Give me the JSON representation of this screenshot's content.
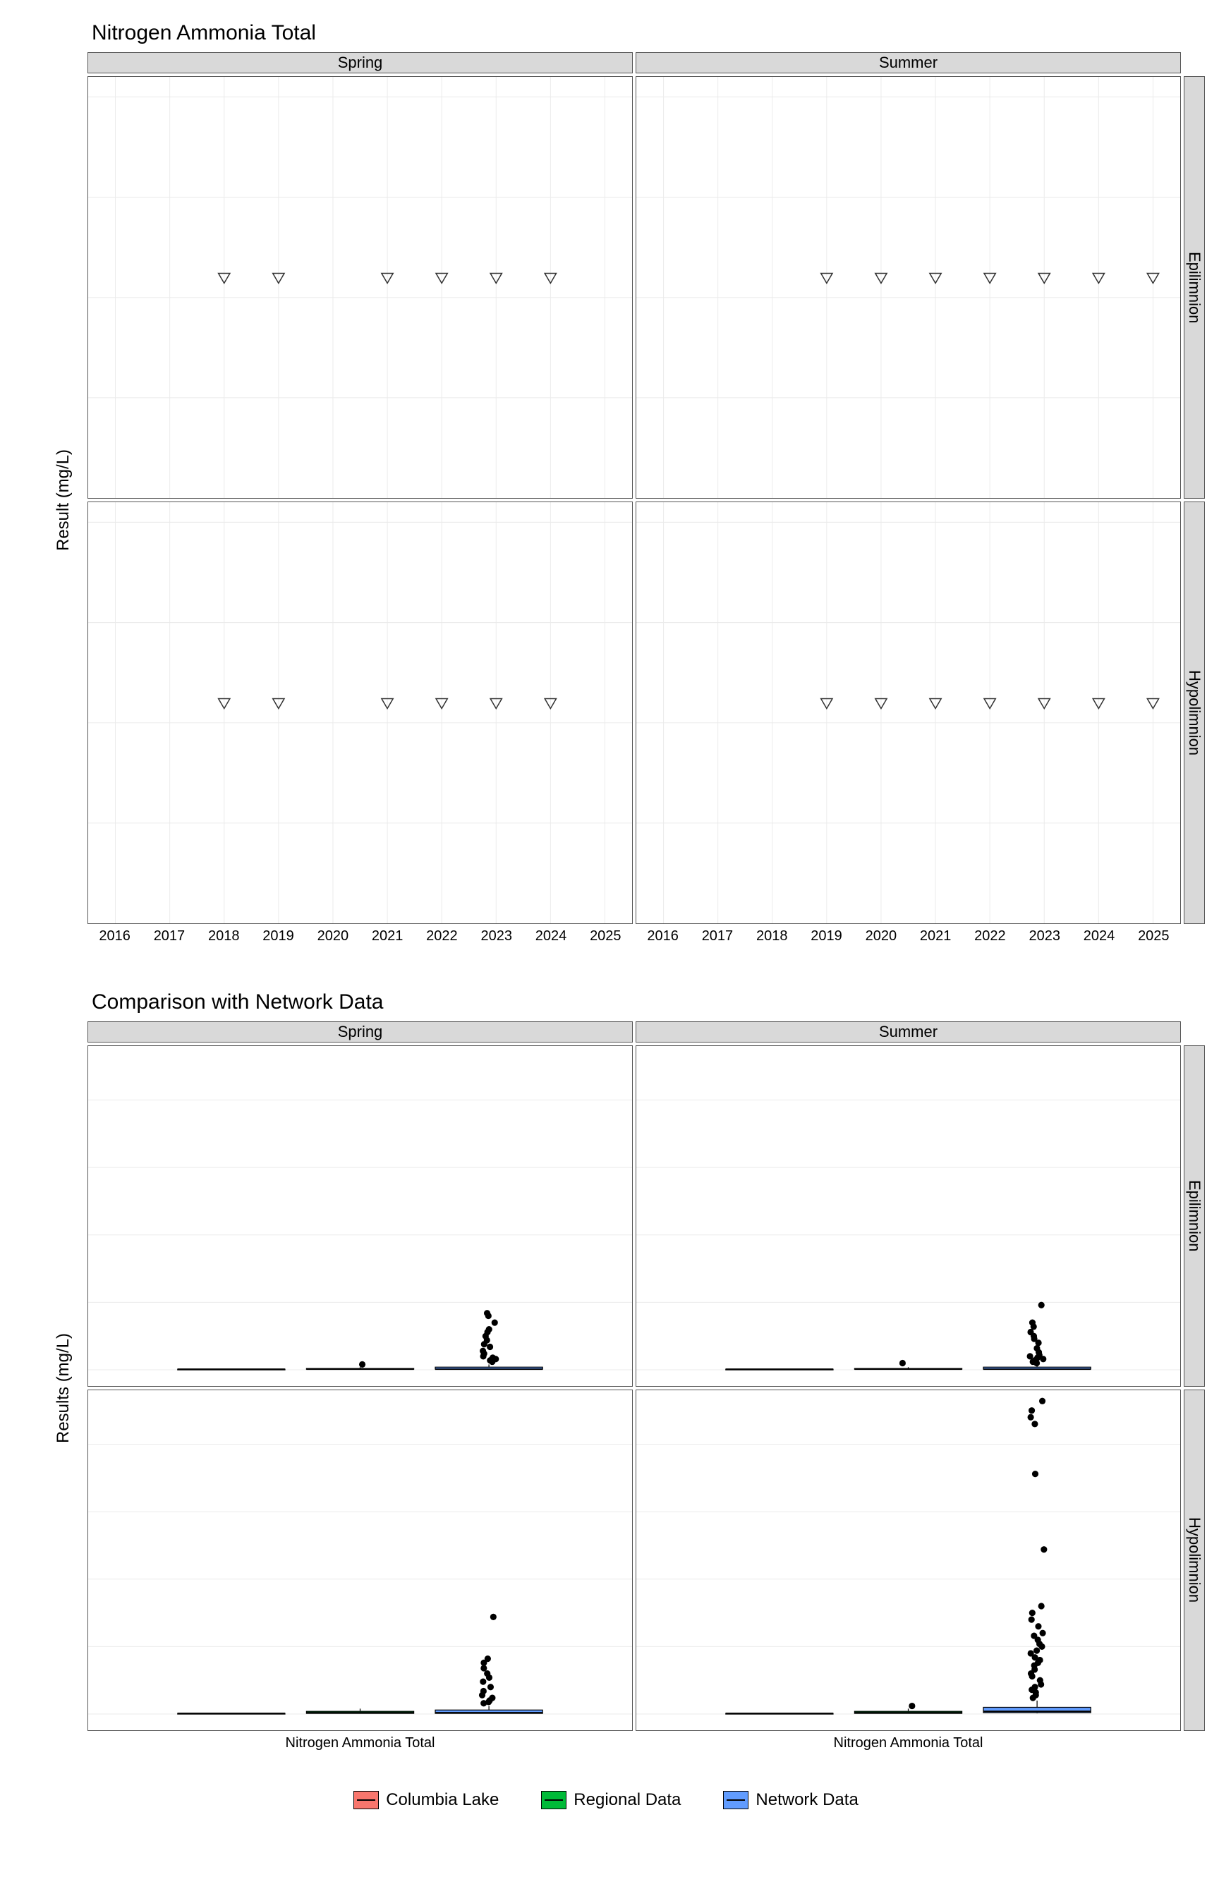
{
  "chart_data": [
    {
      "id": "top",
      "type": "scatter",
      "title": "Nitrogen Ammonia Total",
      "ylabel": "Result (mg/L)",
      "xlabel": "",
      "x_ticks": [
        "2016",
        "2017",
        "2018",
        "2019",
        "2020",
        "2021",
        "2022",
        "2023",
        "2024",
        "2025"
      ],
      "y_ticks": [
        -0.025,
        0.0,
        0.025,
        0.05
      ],
      "ylim": [
        -0.05,
        0.055
      ],
      "col_facets": [
        "Spring",
        "Summer"
      ],
      "row_facets": [
        "Epilimnion",
        "Hypolimnion"
      ],
      "marker": "open-triangle-down",
      "panels": {
        "Spring|Epilimnion": {
          "x": [
            2018,
            2019,
            2021,
            2022,
            2023,
            2024
          ],
          "y": [
            0.005,
            0.005,
            0.005,
            0.005,
            0.005,
            0.005
          ]
        },
        "Summer|Epilimnion": {
          "x": [
            2019,
            2020,
            2021,
            2022,
            2023,
            2024,
            2025
          ],
          "y": [
            0.005,
            0.005,
            0.005,
            0.005,
            0.005,
            0.005,
            0.005
          ]
        },
        "Spring|Hypolimnion": {
          "x": [
            2018,
            2019,
            2021,
            2022,
            2023,
            2024
          ],
          "y": [
            0.005,
            0.005,
            0.005,
            0.005,
            0.005,
            0.005
          ]
        },
        "Summer|Hypolimnion": {
          "x": [
            2019,
            2020,
            2021,
            2022,
            2023,
            2024,
            2025
          ],
          "y": [
            0.005,
            0.005,
            0.005,
            0.005,
            0.005,
            0.005,
            0.005
          ]
        }
      }
    },
    {
      "id": "bottom",
      "type": "boxplot",
      "title": "Comparison with Network Data",
      "ylabel": "Results (mg/L)",
      "xlabel": "",
      "x_category": "Nitrogen Ammonia Total",
      "y_ticks": [
        0.0,
        0.5,
        1.0,
        1.5,
        2.0
      ],
      "ylim": [
        -0.12,
        2.4
      ],
      "col_facets": [
        "Spring",
        "Summer"
      ],
      "row_facets": [
        "Epilimnion",
        "Hypolimnion"
      ],
      "groups": [
        "Columbia Lake",
        "Regional Data",
        "Network Data"
      ],
      "group_colors": {
        "Columbia Lake": "#F8766D",
        "Regional Data": "#00BA38",
        "Network Data": "#619CFF"
      },
      "panels": {
        "Spring|Epilimnion": {
          "box": [
            {
              "g": "Columbia Lake",
              "q1": 0.005,
              "med": 0.005,
              "q3": 0.005,
              "lo": 0.005,
              "hi": 0.005,
              "out": []
            },
            {
              "g": "Regional Data",
              "q1": 0.005,
              "med": 0.005,
              "q3": 0.01,
              "lo": 0.005,
              "hi": 0.02,
              "out": [
                0.04
              ]
            },
            {
              "g": "Network Data",
              "q1": 0.005,
              "med": 0.005,
              "q3": 0.02,
              "lo": 0.005,
              "hi": 0.04,
              "out": [
                0.06,
                0.07,
                0.08,
                0.09,
                0.1,
                0.12,
                0.14,
                0.17,
                0.19,
                0.22,
                0.25,
                0.28,
                0.3,
                0.35,
                0.4,
                0.42
              ]
            }
          ]
        },
        "Summer|Epilimnion": {
          "box": [
            {
              "g": "Columbia Lake",
              "q1": 0.005,
              "med": 0.005,
              "q3": 0.005,
              "lo": 0.005,
              "hi": 0.005,
              "out": []
            },
            {
              "g": "Regional Data",
              "q1": 0.005,
              "med": 0.005,
              "q3": 0.01,
              "lo": 0.005,
              "hi": 0.02,
              "out": [
                0.05
              ]
            },
            {
              "g": "Network Data",
              "q1": 0.005,
              "med": 0.005,
              "q3": 0.02,
              "lo": 0.005,
              "hi": 0.04,
              "out": [
                0.05,
                0.06,
                0.07,
                0.08,
                0.09,
                0.1,
                0.11,
                0.13,
                0.16,
                0.2,
                0.23,
                0.25,
                0.28,
                0.32,
                0.35,
                0.48
              ]
            }
          ]
        },
        "Spring|Hypolimnion": {
          "box": [
            {
              "g": "Columbia Lake",
              "q1": 0.005,
              "med": 0.005,
              "q3": 0.005,
              "lo": 0.005,
              "hi": 0.005,
              "out": []
            },
            {
              "g": "Regional Data",
              "q1": 0.005,
              "med": 0.01,
              "q3": 0.02,
              "lo": 0.005,
              "hi": 0.04,
              "out": []
            },
            {
              "g": "Network Data",
              "q1": 0.005,
              "med": 0.01,
              "q3": 0.03,
              "lo": 0.005,
              "hi": 0.06,
              "out": [
                0.08,
                0.09,
                0.1,
                0.12,
                0.14,
                0.17,
                0.2,
                0.24,
                0.27,
                0.3,
                0.34,
                0.38,
                0.41,
                0.72
              ]
            }
          ]
        },
        "Summer|Hypolimnion": {
          "box": [
            {
              "g": "Columbia Lake",
              "q1": 0.005,
              "med": 0.005,
              "q3": 0.005,
              "lo": 0.005,
              "hi": 0.005,
              "out": []
            },
            {
              "g": "Regional Data",
              "q1": 0.005,
              "med": 0.01,
              "q3": 0.02,
              "lo": 0.005,
              "hi": 0.04,
              "out": [
                0.06
              ]
            },
            {
              "g": "Network Data",
              "q1": 0.01,
              "med": 0.02,
              "q3": 0.05,
              "lo": 0.005,
              "hi": 0.1,
              "out": [
                0.12,
                0.14,
                0.16,
                0.18,
                0.2,
                0.22,
                0.25,
                0.28,
                0.3,
                0.33,
                0.36,
                0.38,
                0.4,
                0.42,
                0.45,
                0.47,
                0.5,
                0.52,
                0.55,
                0.58,
                0.6,
                0.65,
                0.7,
                0.75,
                0.8,
                1.22,
                1.78,
                2.15,
                2.2,
                2.25,
                2.32
              ]
            }
          ]
        }
      }
    }
  ],
  "legend": [
    {
      "label": "Columbia Lake",
      "color": "#F8766D"
    },
    {
      "label": "Regional Data",
      "color": "#00BA38"
    },
    {
      "label": "Network Data",
      "color": "#619CFF"
    }
  ]
}
